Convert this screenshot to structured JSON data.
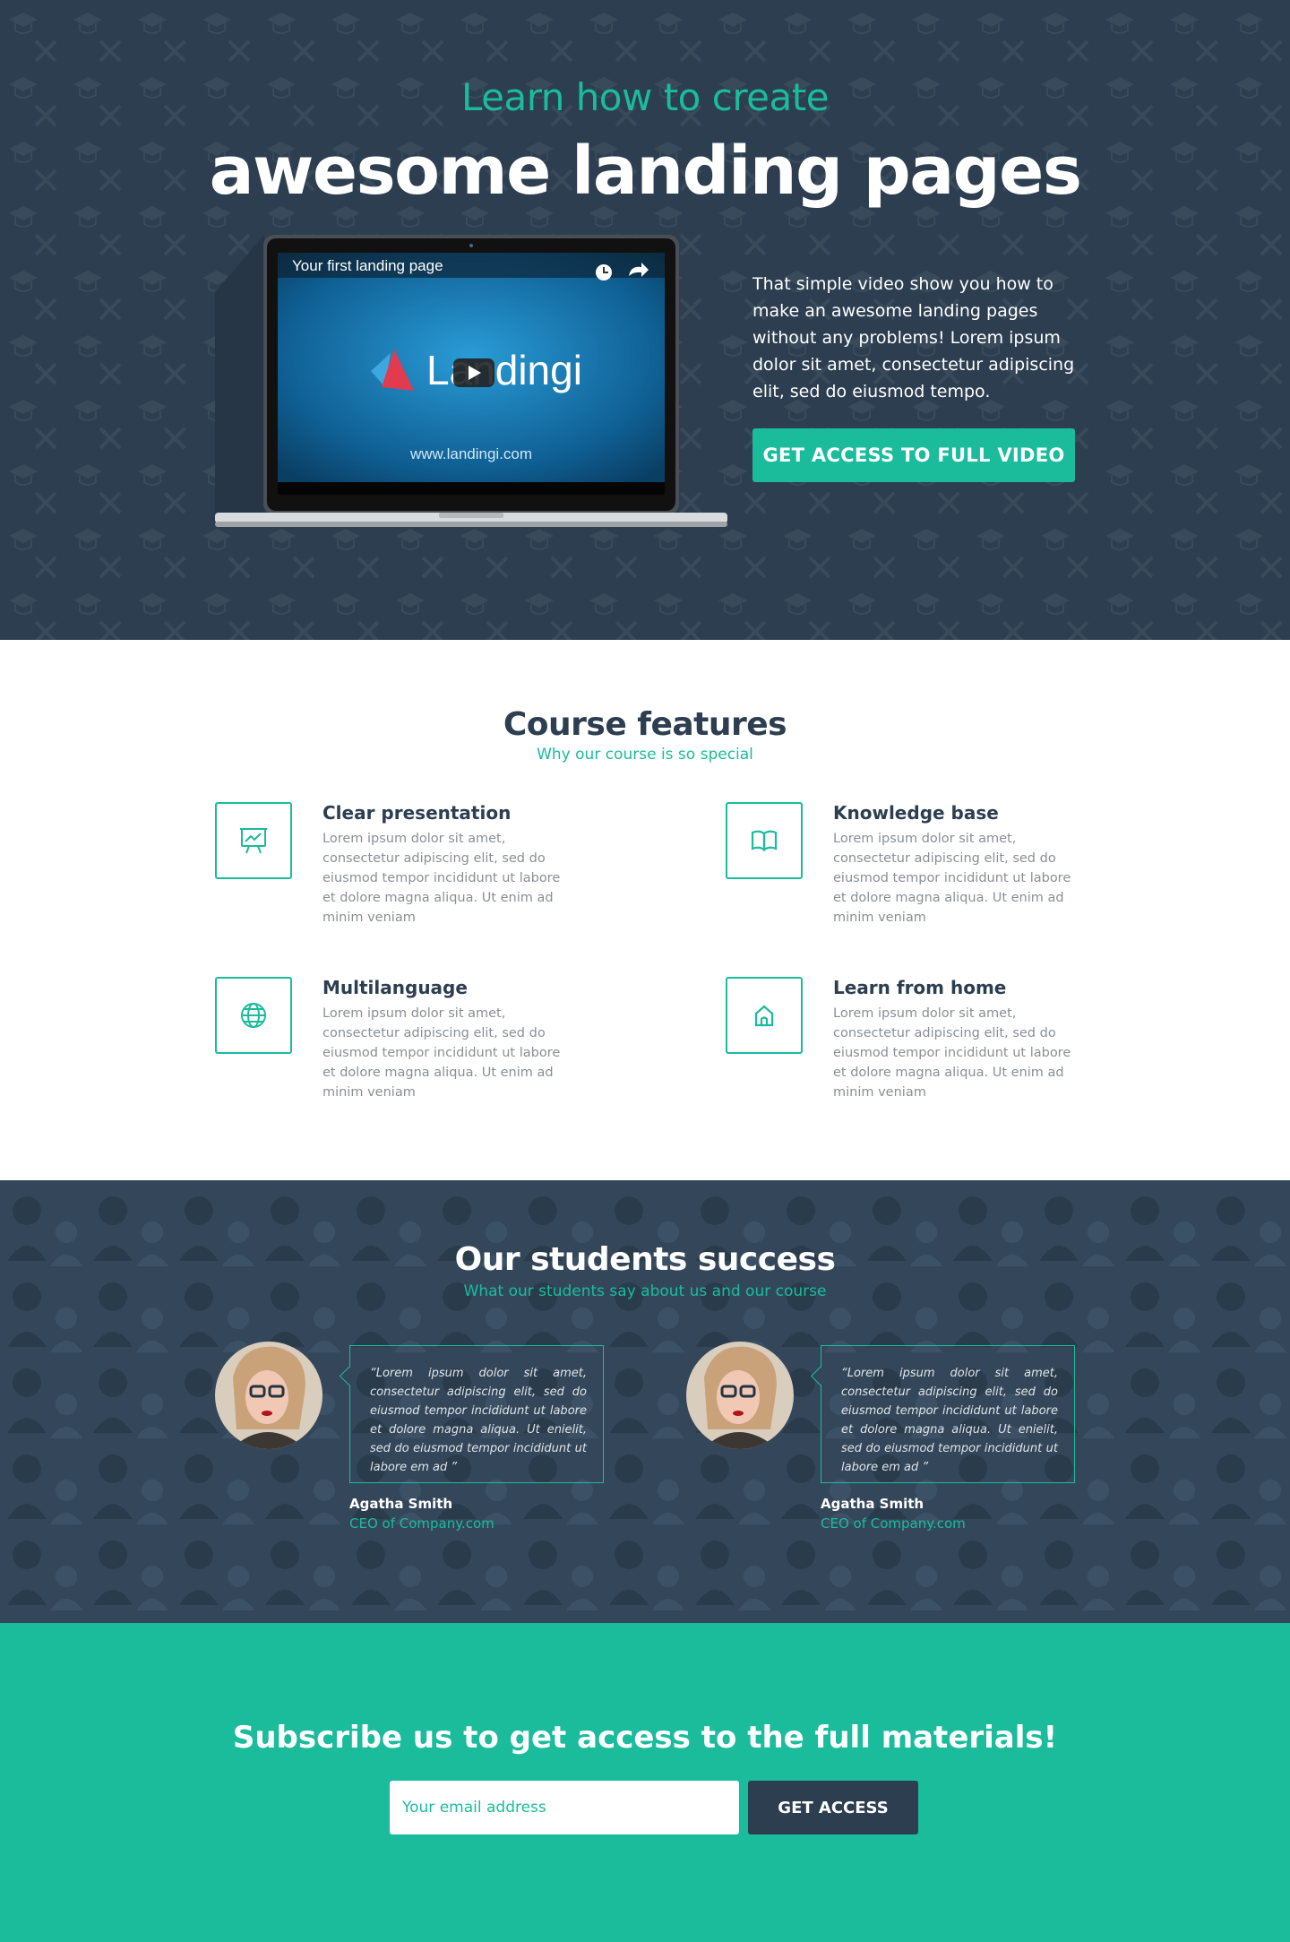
{
  "hero": {
    "subtitle": "Learn how to create",
    "title": "awesome landing pages",
    "video": {
      "title": "Your first landing page",
      "brand": "Landingi",
      "url": "www.landingi.com"
    },
    "description": "That simple video show you how to make an awesome landing pages without any problems! Lorem ipsum dolor sit amet, consectetur adipiscing elit, sed do eiusmod tempo.",
    "cta_label": "GET ACCESS TO FULL VIDEO"
  },
  "features": {
    "title": "Course features",
    "subtitle": "Why our course is so special",
    "items": [
      {
        "icon": "presentation-board-icon",
        "title": "Clear presentation",
        "desc": "Lorem ipsum dolor sit amet, consectetur adipiscing elit, sed do eiusmod tempor incididunt ut labore et dolore magna aliqua. Ut enim ad minim veniam"
      },
      {
        "icon": "open-book-icon",
        "title": "Knowledge base",
        "desc": "Lorem ipsum dolor sit amet, consectetur adipiscing elit, sed do eiusmod tempor incididunt ut labore et dolore magna aliqua. Ut enim ad minim veniam"
      },
      {
        "icon": "globe-icon",
        "title": "Multilanguage",
        "desc": "Lorem ipsum dolor sit amet, consectetur adipiscing elit, sed do eiusmod tempor incididunt ut labore et dolore magna aliqua. Ut enim ad minim veniam"
      },
      {
        "icon": "home-icon",
        "title": "Learn from home",
        "desc": "Lorem ipsum dolor sit amet, consectetur adipiscing elit, sed do eiusmod tempor incididunt ut labore et dolore magna aliqua. Ut enim ad minim veniam"
      }
    ]
  },
  "students": {
    "title": "Our students success",
    "subtitle": "What our students say about us and our course",
    "testimonials": [
      {
        "quote": "“Lorem ipsum dolor sit amet, consectetur adipiscing elit, sed do eiusmod tempor incididunt ut labore et dolore magna aliqua. Ut enielit, sed do eiusmod tempor incididunt ut labore em ad ”",
        "name": "Agatha Smith",
        "role": "CEO of Company.com"
      },
      {
        "quote": "“Lorem ipsum dolor sit amet, consectetur adipiscing elit, sed do eiusmod tempor incididunt ut labore et dolore magna aliqua. Ut enielit, sed do eiusmod tempor incididunt ut labore em ad ”",
        "name": "Agatha Smith",
        "role": "CEO of Company.com"
      }
    ]
  },
  "subscribe": {
    "title_prefix": "Subscribe us to get access to the ",
    "title_bold": "full materials",
    "title_suffix": "!",
    "email_placeholder": "Your email address",
    "button_label": "GET ACCESS"
  },
  "colors": {
    "accent": "#1abc9c",
    "dark": "#2c3e50"
  }
}
